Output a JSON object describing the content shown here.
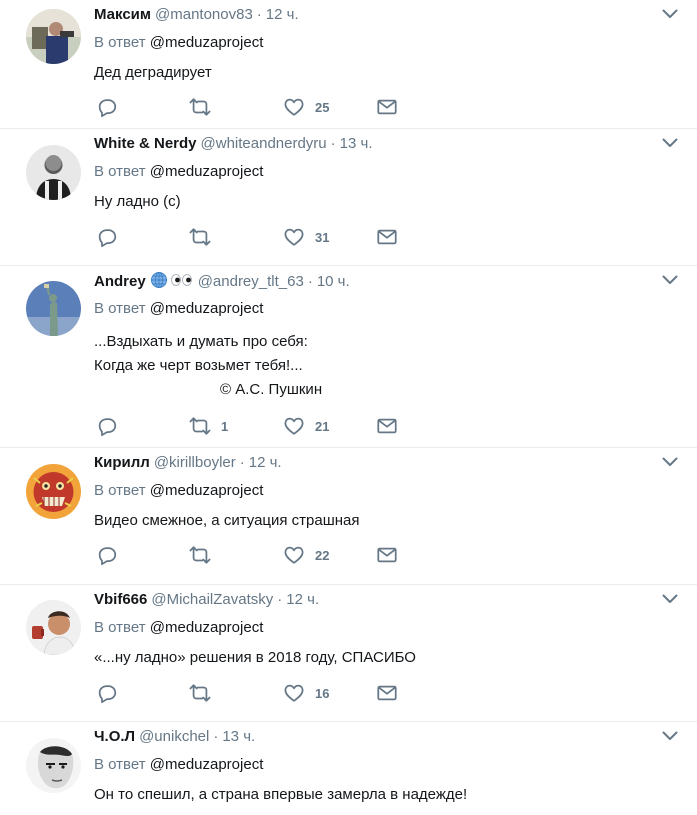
{
  "colors": {
    "text": "#14171a",
    "muted": "#657786",
    "divider": "#e6ecf0",
    "icon": "#657786"
  },
  "icons": {
    "reply": "reply-icon",
    "retweet": "retweet-icon",
    "like": "heart-icon",
    "dm": "envelope-icon",
    "menu": "chevron-down-icon"
  },
  "tweets": [
    {
      "name": "Максим",
      "handle": "@mantonov83",
      "dot": "·",
      "time": "12 ч.",
      "reply_prefix": "В ответ",
      "reply_to": "@meduzaproject",
      "lines": [
        "Дед деградирует"
      ],
      "retweets": "",
      "likes": "25"
    },
    {
      "name": "White & Nerdy",
      "handle": "@whiteandnerdyru",
      "dot": "·",
      "time": "13 ч.",
      "reply_prefix": "В ответ",
      "reply_to": "@meduzaproject",
      "lines": [
        "Ну ладно (с)"
      ],
      "retweets": "",
      "likes": "31"
    },
    {
      "name": "Andrey",
      "name_emoji": "🌐👀",
      "handle": "@andrey_tlt_63",
      "dot": "·",
      "time": "10 ч.",
      "reply_prefix": "В ответ",
      "reply_to": "@meduzaproject",
      "lines": [
        "...Вздыхать и думать про себя:",
        "Когда же черт возьмет тебя!..."
      ],
      "signature": "© А.С. Пушкин",
      "retweets": "1",
      "likes": "21"
    },
    {
      "name": "Кирилл",
      "handle": "@kirillboyler",
      "dot": "·",
      "time": "12 ч.",
      "reply_prefix": "В ответ",
      "reply_to": "@meduzaproject",
      "lines": [
        "Видео смежное, а ситуация страшная"
      ],
      "retweets": "",
      "likes": "22"
    },
    {
      "name": "Vbif666",
      "handle": "@MichailZavatsky",
      "dot": "·",
      "time": "12 ч.",
      "reply_prefix": "В ответ",
      "reply_to": "@meduzaproject",
      "lines": [
        "«...ну ладно» решения в 2018 году, СПАСИБО"
      ],
      "retweets": "",
      "likes": "16"
    },
    {
      "name": "Ч.О.Л",
      "handle": "@unikchel",
      "dot": "·",
      "time": "13 ч.",
      "reply_prefix": "В ответ",
      "reply_to": "@meduzaproject",
      "lines": [
        "Он то спешил, а страна впервые замерла в надежде!"
      ],
      "retweets": "",
      "likes": ""
    }
  ]
}
